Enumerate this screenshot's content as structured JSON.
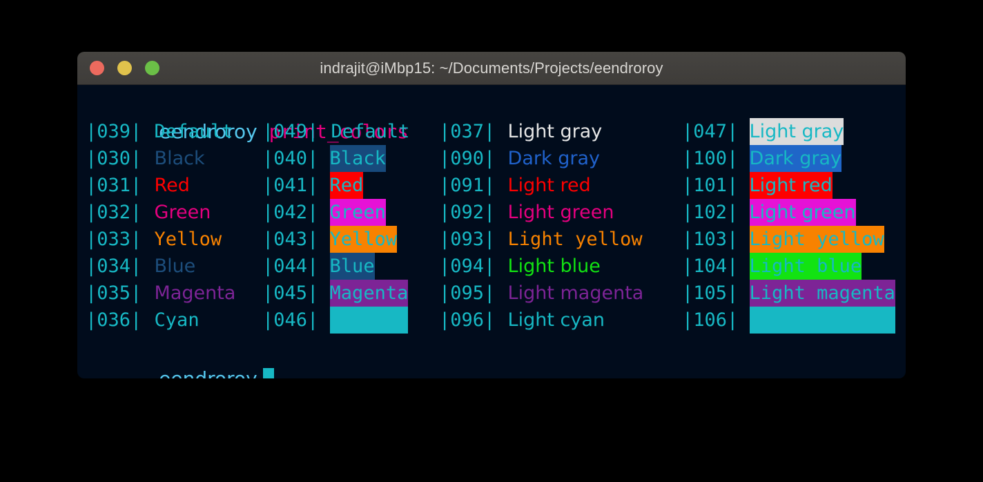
{
  "window": {
    "title": "indrajit@iMbp15: ~/Documents/Projects/eendroroy",
    "buttons": {
      "close_label": "",
      "minimize_label": "",
      "maximize_label": ""
    }
  },
  "terminal": {
    "background": "#010c1c",
    "command_line": {
      "prompt": "eendroroy",
      "prompt_color": "#56c8ee",
      "command": "print_colors",
      "command_color": "#e5007f"
    },
    "prompt_line": {
      "prompt": "eendroroy",
      "prompt_color": "#56c8ee",
      "cursor": "█",
      "cursor_color": "#17b8c4"
    },
    "index_color": "#17b8c4",
    "rows": [
      {
        "col0": {
          "index": "|039|",
          "label": "Default",
          "fg": "#17b8c4",
          "bg": null,
          "font": "mono"
        },
        "col1": {
          "index": "|049|",
          "label": "Default",
          "fg": "#17b8c4",
          "bg": null,
          "font": "mono"
        },
        "col2": {
          "index": "|037|",
          "label": "Light gray",
          "fg": "#e5e5e5",
          "bg": null,
          "font": "prop"
        },
        "col3": {
          "index": "|047|",
          "label": "Light gray",
          "fg": "#17b8c4",
          "bg": "#dcdcdc",
          "font": "prop"
        }
      },
      {
        "col0": {
          "index": "|030|",
          "label": "Black",
          "fg": "#1d4e7c",
          "bg": null,
          "font": "prop"
        },
        "col1": {
          "index": "|040|",
          "label": "Black",
          "fg": "#17b8c4",
          "bg": "#174a7c",
          "font": "mono"
        },
        "col2": {
          "index": "|090|",
          "label": "Dark gray",
          "fg": "#2062cc",
          "bg": null,
          "font": "prop"
        },
        "col3": {
          "index": "|100|",
          "label": "Dark gray",
          "fg": "#17b8c4",
          "bg": "#1f66c8",
          "font": "prop"
        }
      },
      {
        "col0": {
          "index": "|031|",
          "label": "Red",
          "fg": "#fe0000",
          "bg": null,
          "font": "prop"
        },
        "col1": {
          "index": "|041|",
          "label": "Red",
          "fg": "#17b8c4",
          "bg": "#fe0000",
          "font": "mono"
        },
        "col2": {
          "index": "|091|",
          "label": "Light red",
          "fg": "#fe0000",
          "bg": null,
          "font": "prop"
        },
        "col3": {
          "index": "|101|",
          "label": "Light red",
          "fg": "#17b8c4",
          "bg": "#fe0000",
          "font": "prop"
        }
      },
      {
        "col0": {
          "index": "|032|",
          "label": "Green",
          "fg": "#e5007f",
          "bg": null,
          "font": "prop"
        },
        "col1": {
          "index": "|042|",
          "label": "Green",
          "fg": "#17b8c4",
          "bg": "#e512d6",
          "font": "mono"
        },
        "col2": {
          "index": "|092|",
          "label": "Light green",
          "fg": "#e5007f",
          "bg": null,
          "font": "prop"
        },
        "col3": {
          "index": "|102|",
          "label": "Light green",
          "fg": "#17b8c4",
          "bg": "#e512d6",
          "font": "prop"
        }
      },
      {
        "col0": {
          "index": "|033|",
          "label": "Yellow",
          "fg": "#f88200",
          "bg": null,
          "font": "mono"
        },
        "col1": {
          "index": "|043|",
          "label": "Yellow",
          "fg": "#17b8c4",
          "bg": "#f88200",
          "font": "mono"
        },
        "col2": {
          "index": "|093|",
          "label": "Light yellow",
          "fg": "#f88200",
          "bg": null,
          "font": "mono"
        },
        "col3": {
          "index": "|103|",
          "label": "Light yellow",
          "fg": "#17b8c4",
          "bg": "#f88200",
          "font": "mono"
        }
      },
      {
        "col0": {
          "index": "|034|",
          "label": "Blue",
          "fg": "#1d4e7c",
          "bg": null,
          "font": "prop"
        },
        "col1": {
          "index": "|044|",
          "label": "Blue",
          "fg": "#17b8c4",
          "bg": "#174a7c",
          "font": "mono"
        },
        "col2": {
          "index": "|094|",
          "label": "Light blue",
          "fg": "#12e312",
          "bg": null,
          "font": "prop"
        },
        "col3": {
          "index": "|104|",
          "label": "Light blue",
          "fg": "#17b8c4",
          "bg": "#12e312",
          "font": "mono"
        }
      },
      {
        "col0": {
          "index": "|035|",
          "label": "Magenta",
          "fg": "#7d2496",
          "bg": null,
          "font": "prop"
        },
        "col1": {
          "index": "|045|",
          "label": "Magenta",
          "fg": "#17b8c4",
          "bg": "#7d2496",
          "font": "mono"
        },
        "col2": {
          "index": "|095|",
          "label": "Light magenta",
          "fg": "#7d2496",
          "bg": null,
          "font": "prop"
        },
        "col3": {
          "index": "|105|",
          "label": "Light magenta",
          "fg": "#17b8c4",
          "bg": "#7d2496",
          "font": "mono"
        }
      },
      {
        "col0": {
          "index": "|036|",
          "label": "Cyan",
          "fg": "#17b8c4",
          "bg": null,
          "font": "mono"
        },
        "col1": {
          "index": "|046|",
          "label": "       ",
          "fg": "#17b8c4",
          "bg": "#17b8c4",
          "font": "mono"
        },
        "col2": {
          "index": "|096|",
          "label": "Light cyan",
          "fg": "#17b8c4",
          "bg": null,
          "font": "prop"
        },
        "col3": {
          "index": "|106|",
          "label": "             ",
          "fg": "#17b8c4",
          "bg": "#17b8c4",
          "font": "mono"
        }
      }
    ]
  }
}
